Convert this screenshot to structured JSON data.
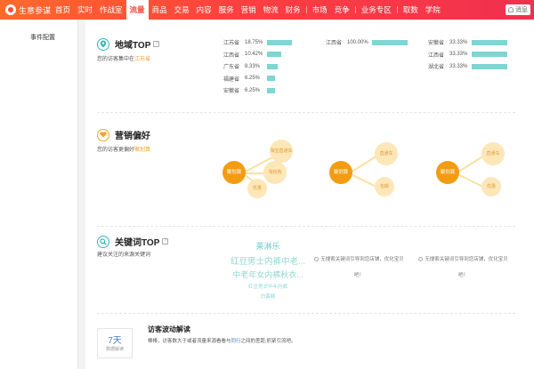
{
  "brand": {
    "name": "生意参谋"
  },
  "nav": {
    "items": [
      {
        "label": "首页"
      },
      {
        "label": "实时"
      },
      {
        "label": "作战室"
      },
      {
        "label": "流量",
        "active": true
      },
      {
        "label": "商品"
      },
      {
        "label": "交易"
      },
      {
        "label": "内容"
      },
      {
        "label": "服务"
      },
      {
        "label": "营销"
      },
      {
        "label": "物流"
      },
      {
        "label": "财务"
      },
      {
        "label": "市场"
      },
      {
        "label": "竞争"
      },
      {
        "label": "业务专区"
      },
      {
        "label": "取数"
      },
      {
        "label": "学院"
      }
    ],
    "message": "消息"
  },
  "sidebar": {
    "items": [
      {
        "label": "事件配置"
      }
    ]
  },
  "region": {
    "title": "地域TOP",
    "subtitle_prefix": "您的访客集中在",
    "subtitle_highlight": "江苏省",
    "columns": [
      {
        "rows": [
          {
            "name": "江苏省",
            "pct": "18.75%",
            "value": 18.75
          },
          {
            "name": "江西省",
            "pct": "10.42%",
            "value": 10.42
          },
          {
            "name": "广东省",
            "pct": "8.33%",
            "value": 8.33
          },
          {
            "name": "福建省",
            "pct": "6.25%",
            "value": 6.25
          },
          {
            "name": "安徽省",
            "pct": "6.25%",
            "value": 6.25
          }
        ]
      },
      {
        "rows": [
          {
            "name": "江西省",
            "pct": "100.00%",
            "value": 100
          }
        ]
      },
      {
        "rows": [
          {
            "name": "安徽省",
            "pct": "33.33%",
            "value": 33.33
          },
          {
            "name": "江西省",
            "pct": "33.33%",
            "value": 33.33
          },
          {
            "name": "湖北省",
            "pct": "33.33%",
            "value": 33.33
          }
        ]
      }
    ]
  },
  "marketing": {
    "title": "营销偏好",
    "subtitle_prefix": "您的访客更偏好",
    "subtitle_highlight": "聚划算",
    "groups": [
      {
        "main": "聚划算",
        "subs": [
          "淘宝直通车",
          "淘抢购",
          "优惠"
        ]
      },
      {
        "main": "聚划算",
        "subs": [
          "直通车",
          "包邮"
        ]
      },
      {
        "main": "聚划算",
        "subs": [
          "直通车",
          "优惠"
        ]
      }
    ]
  },
  "keywords": {
    "title": "关键词TOP",
    "subtitle": "建议关注的来源关键词",
    "cloud": [
      "莱淋乐",
      "红豆男士内裤中老...",
      "中老年女内裤秋衣...",
      "红豆男式中年内裤",
      "白蛋糕"
    ],
    "empty_lines": [
      "无搜索关键词引导到您店铺，优化宝贝",
      "吧！"
    ]
  },
  "visit": {
    "days": "7天",
    "caption": "数据解读",
    "title": "访客波动解读",
    "text_prefix": "棒棒，访客数大于或者流量来源看看与",
    "link": "同行",
    "text_suffix": "之间的差距,抓紧引流吧。"
  }
}
